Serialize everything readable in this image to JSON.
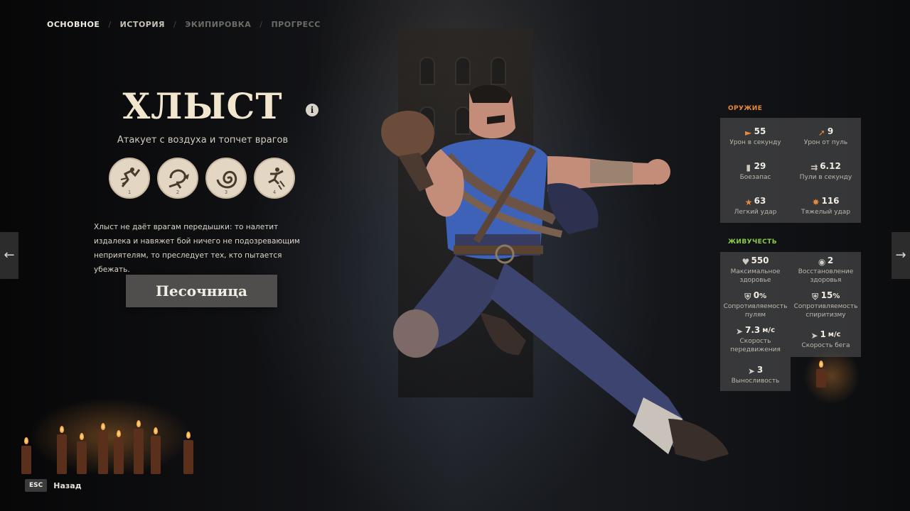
{
  "nav": {
    "tabs": [
      {
        "label": "ОСНОВНОЕ"
      },
      {
        "label": "ИСТОРИЯ"
      },
      {
        "label": "ЭКИПИРОВКА"
      },
      {
        "label": "ПРОГРЕСС"
      }
    ],
    "separator": "/"
  },
  "hero": {
    "name": "ХЛЫСТ",
    "subtitle": "Атакует с воздуха и топчет врагов",
    "info_icon": "i",
    "description": "Хлыст не даёт врагам передышки: то налетит издалека и навяжет бой ничего не подозревающим неприятелям, то преследует тех, кто пытается убежать.",
    "abilities": [
      {
        "num": "1",
        "icon": "ability-lash-icon"
      },
      {
        "num": "2",
        "icon": "ability-grapple-icon"
      },
      {
        "num": "3",
        "icon": "ability-whip-icon"
      },
      {
        "num": "4",
        "icon": "ability-slam-icon"
      }
    ]
  },
  "sandbox_button": "Песочница",
  "weapon": {
    "label": "ОРУЖИЕ",
    "stats": [
      {
        "value": "55",
        "label": "Урон в секунду",
        "icon": "dps-icon"
      },
      {
        "value": "9",
        "label": "Урон от пуль",
        "icon": "bullet-damage-icon"
      },
      {
        "value": "29",
        "label": "Боезапас",
        "icon": "ammo-icon"
      },
      {
        "value": "6.12",
        "label": "Пули в секунду",
        "icon": "fire-rate-icon"
      },
      {
        "value": "63",
        "label": "Легкий удар",
        "icon": "light-melee-icon"
      },
      {
        "value": "116",
        "label": "Тяжелый удар",
        "icon": "heavy-melee-icon"
      }
    ]
  },
  "vitality": {
    "label": "ЖИВУЧЕСТЬ",
    "stats": [
      {
        "value": "550",
        "unit": "",
        "label": "Максимальное здоровье",
        "icon": "heart-icon"
      },
      {
        "value": "2",
        "unit": "",
        "label": "Восстановление здоровья",
        "icon": "health-regen-icon"
      },
      {
        "value": "0",
        "unit": "%",
        "label": "Сопротивляемость пулям",
        "icon": "bullet-resist-icon"
      },
      {
        "value": "15",
        "unit": "%",
        "label": "Сопротивляемость спиритизму",
        "icon": "spirit-resist-icon"
      },
      {
        "value": "7.3",
        "unit": "м/с",
        "label": "Скорость передвижения",
        "icon": "move-speed-icon"
      },
      {
        "value": "1",
        "unit": "м/с",
        "label": "Скорость бега",
        "icon": "sprint-speed-icon"
      },
      {
        "value": "3",
        "unit": "",
        "label": "Выносливость",
        "icon": "stamina-icon"
      }
    ]
  },
  "footer": {
    "esc_key": "ESC",
    "back_label": "Назад"
  },
  "colors": {
    "weapon_accent": "#e8883a",
    "vitality_accent": "#8dcc4a",
    "title": "#f3e6cf"
  }
}
